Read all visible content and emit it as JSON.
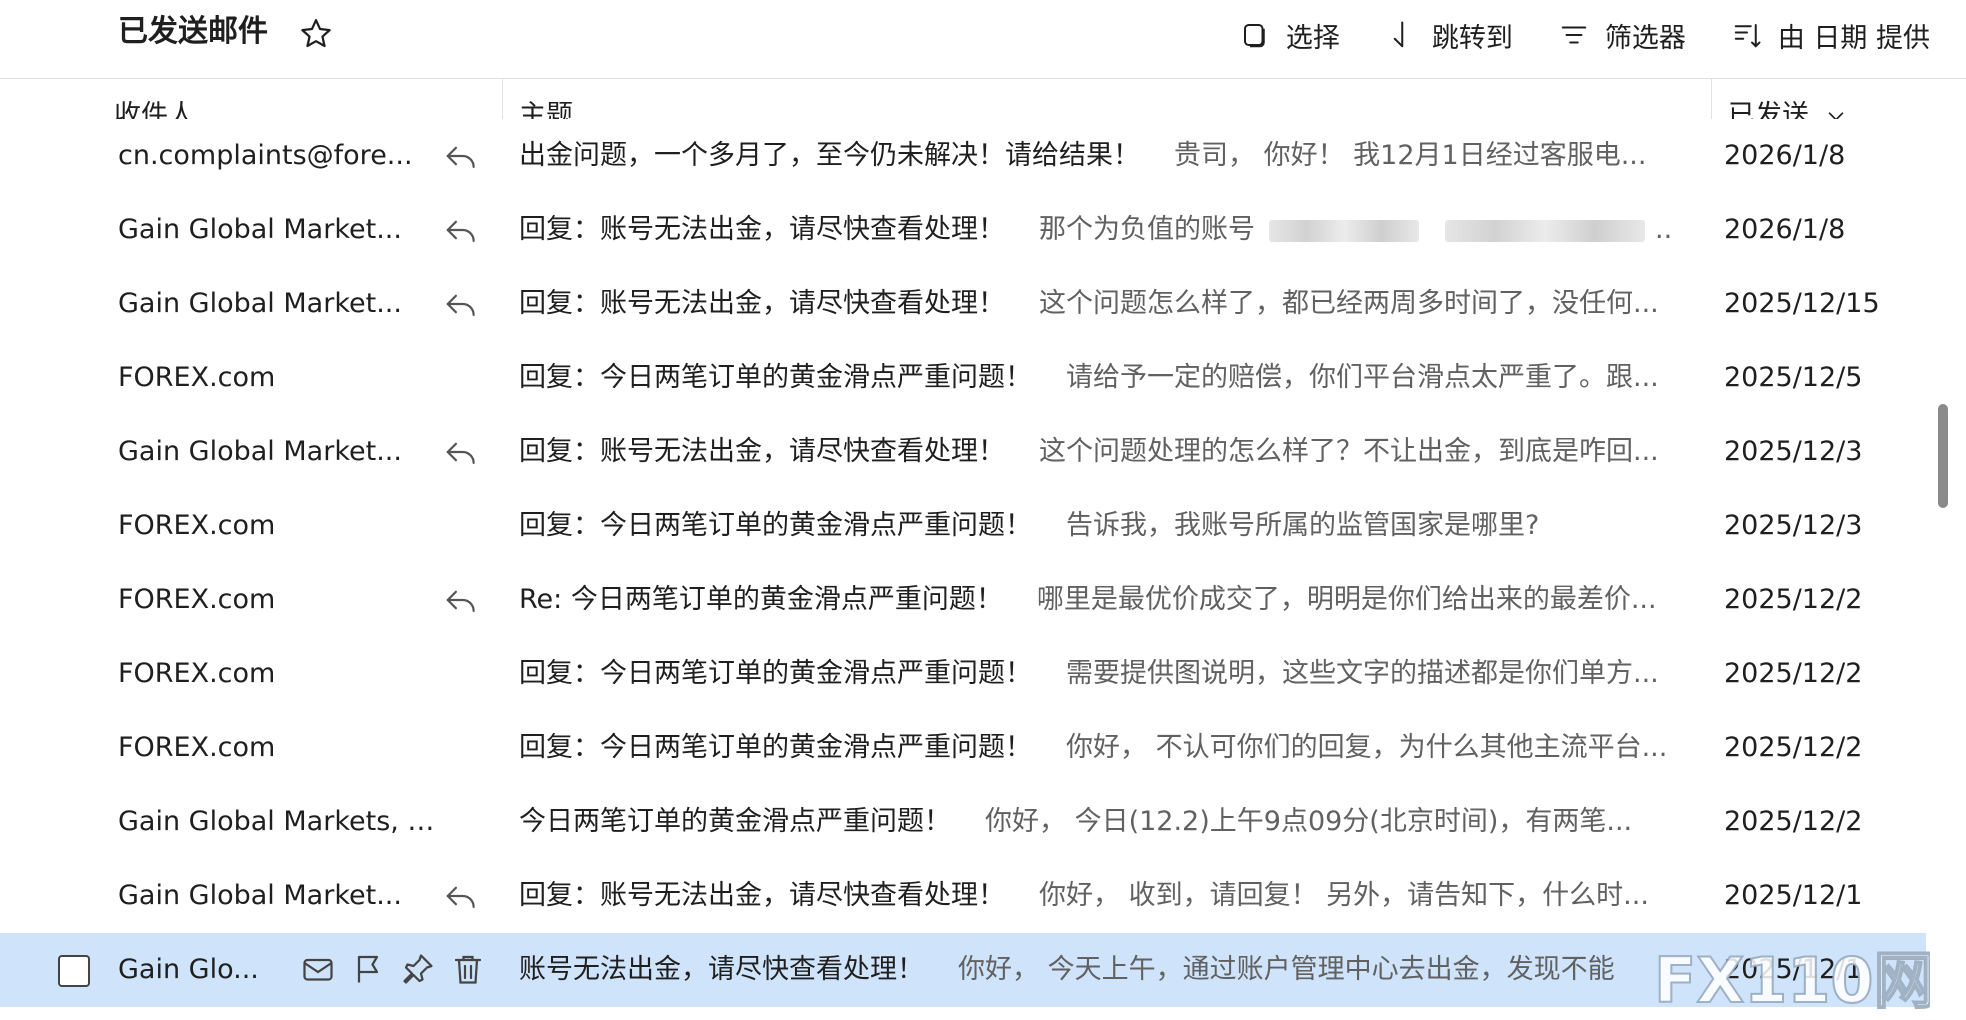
{
  "header": {
    "folder_title": "已发送邮件",
    "tools": [
      {
        "label": "选择",
        "icon": "select-icon"
      },
      {
        "label": "跳转到",
        "icon": "jump-arrow-icon"
      },
      {
        "label": "筛选器",
        "icon": "filter-icon"
      },
      {
        "label": "由 日期 提供",
        "icon": "sort-icon"
      }
    ]
  },
  "columns": {
    "recipient": "收件人",
    "subject": "主题",
    "sent": "已发送"
  },
  "rows": [
    {
      "sender": "cn.complaints@fore...",
      "replied": true,
      "subject": "出金问题，一个多月了，至今仍未解决！请给结果！",
      "preview": "贵司，  你好！ 我12月1日经过客服电...",
      "date": "2026/1/8"
    },
    {
      "sender": "Gain Global Market...",
      "replied": true,
      "subject": "回复：账号无法出金，请尽快查看处理！",
      "preview": "那个为负值的账号",
      "date": "2026/1/8"
    },
    {
      "sender": "Gain Global Market...",
      "replied": true,
      "subject": "回复：账号无法出金，请尽快查看处理！",
      "preview": "这个问题怎么样了，都已经两周多时间了，没任何...",
      "date": "2025/12/15"
    },
    {
      "sender": "FOREX.com",
      "replied": false,
      "subject": "回复：今日两笔订单的黄金滑点严重问题！",
      "preview": "请给予一定的赔偿，你们平台滑点太严重了。跟...",
      "date": "2025/12/5"
    },
    {
      "sender": "Gain Global Market...",
      "replied": true,
      "subject": "回复：账号无法出金，请尽快查看处理！",
      "preview": "这个问题处理的怎么样了？不让出金，到底是咋回...",
      "date": "2025/12/3"
    },
    {
      "sender": "FOREX.com",
      "replied": false,
      "subject": "回复：今日两笔订单的黄金滑点严重问题！",
      "preview": "告诉我，我账号所属的监管国家是哪里?",
      "date": "2025/12/3"
    },
    {
      "sender": "FOREX.com",
      "replied": true,
      "subject": "Re: 今日两笔订单的黄金滑点严重问题！",
      "preview": "哪里是最优价成交了，明明是你们给出来的最差价...",
      "date": "2025/12/2"
    },
    {
      "sender": "FOREX.com",
      "replied": false,
      "subject": "回复：今日两笔订单的黄金滑点严重问题！",
      "preview": "需要提供图说明，这些文字的描述都是你们单方...",
      "date": "2025/12/2"
    },
    {
      "sender": "FOREX.com",
      "replied": false,
      "subject": "回复：今日两笔订单的黄金滑点严重问题！",
      "preview": "你好，  不认可你们的回复，为什么其他主流平台...",
      "date": "2025/12/2"
    },
    {
      "sender": "Gain Global Markets, I...",
      "replied": false,
      "subject": "今日两笔订单的黄金滑点严重问题！",
      "preview": "你好，  今日(12.2)上午9点09分(北京时间)，有两笔...",
      "date": "2025/12/2"
    },
    {
      "sender": "Gain Global Market...",
      "replied": true,
      "subject": "回复：账号无法出金，请尽快查看处理！",
      "preview": "你好，  收到，请回复！ 另外，请告知下，什么时...",
      "date": "2025/12/1"
    },
    {
      "sender": "Gain Glo...",
      "replied": false,
      "selected": true,
      "subject": "账号无法出金，请尽快查看处理！",
      "preview": "你好，  今天上午，通过账户管理中心去出金，发现不能",
      "date": "2025/12/1"
    }
  ],
  "watermark": "FX110网",
  "colors": {
    "selected_row": "#cfe4fa",
    "divider": "#e4e4e4",
    "preview_text": "#616161"
  }
}
